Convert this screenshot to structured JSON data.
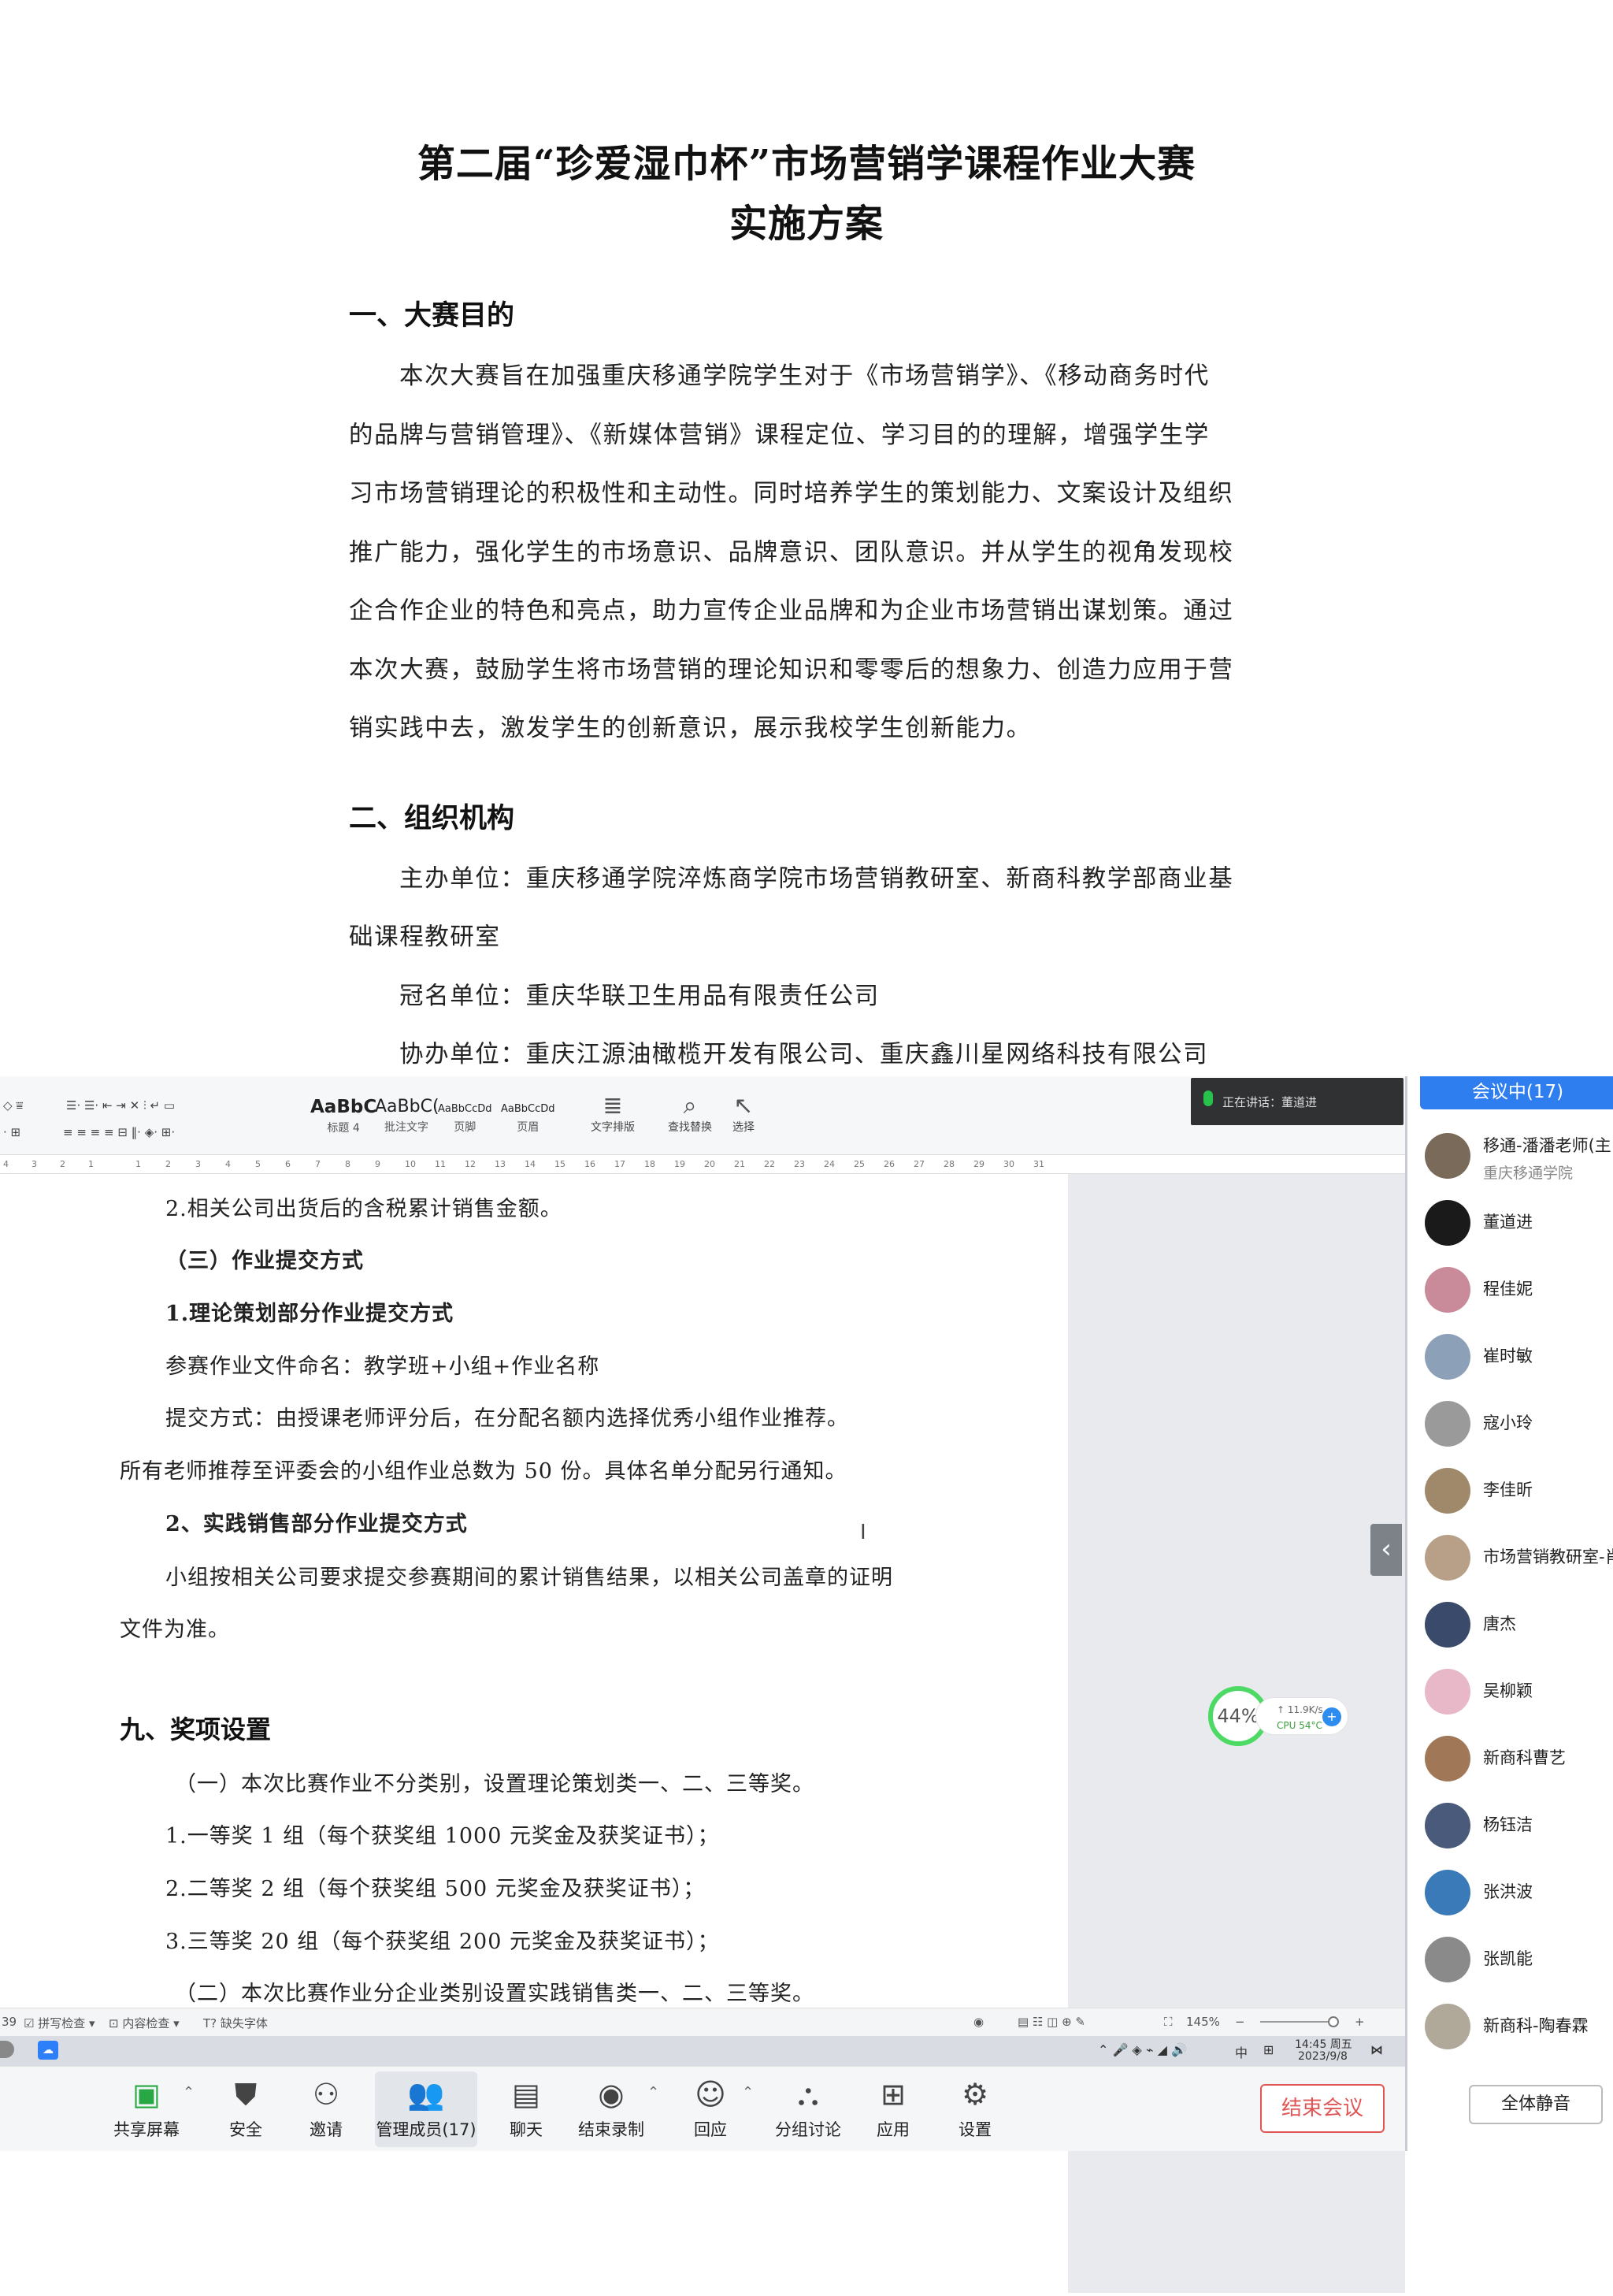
{
  "top_document": {
    "title_line1": "第二届“珍爱湿巾杯”市场营销学课程作业大赛",
    "title_line2": "实施方案",
    "section1_heading": "一、大赛目的",
    "section1_lines": [
      "本次大赛旨在加强重庆移通学院学生对于《市场营销学》、《移动商务时代",
      "的品牌与营销管理》、《新媒体营销》课程定位、学习目的的理解，增强学生学",
      "习市场营销理论的积极性和主动性。同时培养学生的策划能力、文案设计及组织",
      "推广能力，强化学生的市场意识、品牌意识、团队意识。并从学生的视角发现校",
      "企合作企业的特色和亮点，助力宣传企业品牌和为企业市场营销出谋划策。通过",
      "本次大赛，鼓励学生将市场营销的理论知识和零零后的想象力、创造力应用于营",
      "销实践中去，激发学生的创新意识，展示我校学生创新能力。"
    ],
    "section2_heading": "二、组织机构",
    "section2_lines": [
      "主办单位：重庆移通学院淬炼商学院市场营销教研室、新商科教学部商业基",
      "础课程教研室",
      "冠名单位：重庆华联卫生用品有限责任公司",
      "协办单位：重庆江源油橄榄开发有限公司、重庆鑫川星网络科技有限公司"
    ]
  },
  "word_toolbar": {
    "styles": [
      {
        "sample": "AaBbC",
        "label": "标题 4"
      },
      {
        "sample": "AaBbC(",
        "label": "批注文字"
      },
      {
        "sample": "AaBbCcDd",
        "label": "页脚"
      },
      {
        "sample": "AaBbCcDd",
        "label": "页眉"
      }
    ],
    "text_layout": "文字排版",
    "find_replace": "查找替换",
    "select": "选择"
  },
  "ruler_ticks": [
    "4",
    "3",
    "2",
    "1",
    "1",
    "2",
    "3",
    "4",
    "5",
    "6",
    "7",
    "8",
    "9",
    "10",
    "11",
    "12",
    "13",
    "14",
    "15",
    "16",
    "17",
    "18",
    "19",
    "20",
    "21",
    "22",
    "23",
    "24",
    "25",
    "26",
    "27",
    "28",
    "29",
    "30",
    "31"
  ],
  "speaking": {
    "text": "正在讲话：董道进"
  },
  "word_document": {
    "line1": "2.相关公司出货后的含税累计销售金额。",
    "line2": "（三）作业提交方式",
    "line3": "1.理论策划部分作业提交方式",
    "line4": "参赛作业文件命名：教学班+小组+作业名称",
    "line5": "提交方式：由授课老师评分后，在分配名额内选择优秀小组作业推荐。",
    "line6": "所有老师推荐至评委会的小组作业总数为 50 份。具体名单分配另行通知。",
    "line7": "2、实践销售部分作业提交方式",
    "line8": "小组按相关公司要求提交参赛期间的累计销售结果，以相关公司盖章的证明",
    "line9": "文件为准。",
    "heading9": "九、奖项设置",
    "line10": "（一）本次比赛作业不分类别，设置理论策划类一、二、三等奖。",
    "line11": "1.一等奖 1 组（每个获奖组 1000 元奖金及获奖证书）；",
    "line12": "2.二等奖 2 组（每个获奖组 500 元奖金及获奖证书）；",
    "line13": "3.三等奖 20 组（每个获奖组 200 元奖金及获奖证书）；",
    "line14": "（二）本次比赛作业分企业类别设置实践销售类一、二、三等奖。"
  },
  "net_widget": {
    "percent": "44%",
    "speed": "↑ 11.9K/s",
    "cpu": "CPU 54°C",
    "cpu_color": "#3c9e3c"
  },
  "status_bar": {
    "page_fragment": "39",
    "spell_check": "拼写检查",
    "content_check": "内容检查",
    "missing_font": "缺失字体",
    "zoom": "145%"
  },
  "taskbar": {
    "ime": "中",
    "time": "14:45 周五",
    "date": "2023/9/8"
  },
  "meeting_toolbar": {
    "buttons": [
      {
        "icon": "share-screen-icon",
        "label": "共享屏幕"
      },
      {
        "icon": "shield-icon",
        "label": "安全"
      },
      {
        "icon": "invite-icon",
        "label": "邀请"
      },
      {
        "icon": "members-icon",
        "label": "管理成员(17)"
      },
      {
        "icon": "chat-icon",
        "label": "聊天"
      },
      {
        "icon": "record-icon",
        "label": "结束录制"
      },
      {
        "icon": "reaction-icon",
        "label": "回应"
      },
      {
        "icon": "breakout-icon",
        "label": "分组讨论"
      },
      {
        "icon": "apps-icon",
        "label": "应用"
      },
      {
        "icon": "settings-icon",
        "label": "设置"
      }
    ],
    "end_meeting": "结束会议",
    "end_color": "#e05555"
  },
  "participants": {
    "header": "会议中(17)",
    "header_color": "#2f7ef0",
    "list": [
      {
        "name": "移通-潘潘老师(主",
        "sub": "重庆移通学院",
        "color": "#7a6a5a"
      },
      {
        "name": "董道进",
        "sub": "",
        "color": "#1a1a1a"
      },
      {
        "name": "程佳妮",
        "sub": "",
        "color": "#c98a9a"
      },
      {
        "name": "崔时敏",
        "sub": "",
        "color": "#8ca0b8"
      },
      {
        "name": "寇小玲",
        "sub": "",
        "color": "#9a9a9a"
      },
      {
        "name": "李佳昕",
        "sub": "",
        "color": "#a0886a"
      },
      {
        "name": "市场营销教研室-肖",
        "sub": "",
        "color": "#b8a088"
      },
      {
        "name": "唐杰",
        "sub": "",
        "color": "#3a4a6a"
      },
      {
        "name": "吴柳颖",
        "sub": "",
        "color": "#e8b8c8"
      },
      {
        "name": "新商科曹艺",
        "sub": "",
        "color": "#a07858"
      },
      {
        "name": "杨钰洁",
        "sub": "",
        "color": "#4a5a7a"
      },
      {
        "name": "张洪波",
        "sub": "",
        "color": "#3a7ab8"
      },
      {
        "name": "张凯能",
        "sub": "",
        "color": "#8a8a8a"
      },
      {
        "name": "新商科-陶春霖",
        "sub": "",
        "color": "#b0a898"
      }
    ],
    "mute_all": "全体静音"
  }
}
